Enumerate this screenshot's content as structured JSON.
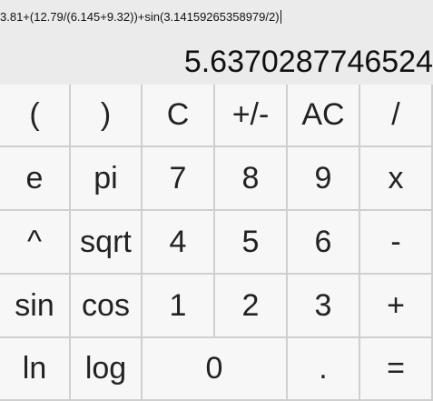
{
  "display": {
    "expression": "3.81+(12.79/(6.145+9.32))+sin(3.14159265358979/2)",
    "result": "5.6370287746524"
  },
  "keys": {
    "row1": [
      "(",
      ")",
      "C",
      "+/-",
      "AC",
      "/"
    ],
    "row2": [
      "e",
      "pi",
      "7",
      "8",
      "9",
      "x"
    ],
    "row3": [
      "^",
      "sqrt",
      "4",
      "5",
      "6",
      "-"
    ],
    "row4": [
      "sin",
      "cos",
      "1",
      "2",
      "3",
      "+"
    ],
    "row5": [
      "ln",
      "log",
      "0",
      ".",
      "="
    ]
  }
}
